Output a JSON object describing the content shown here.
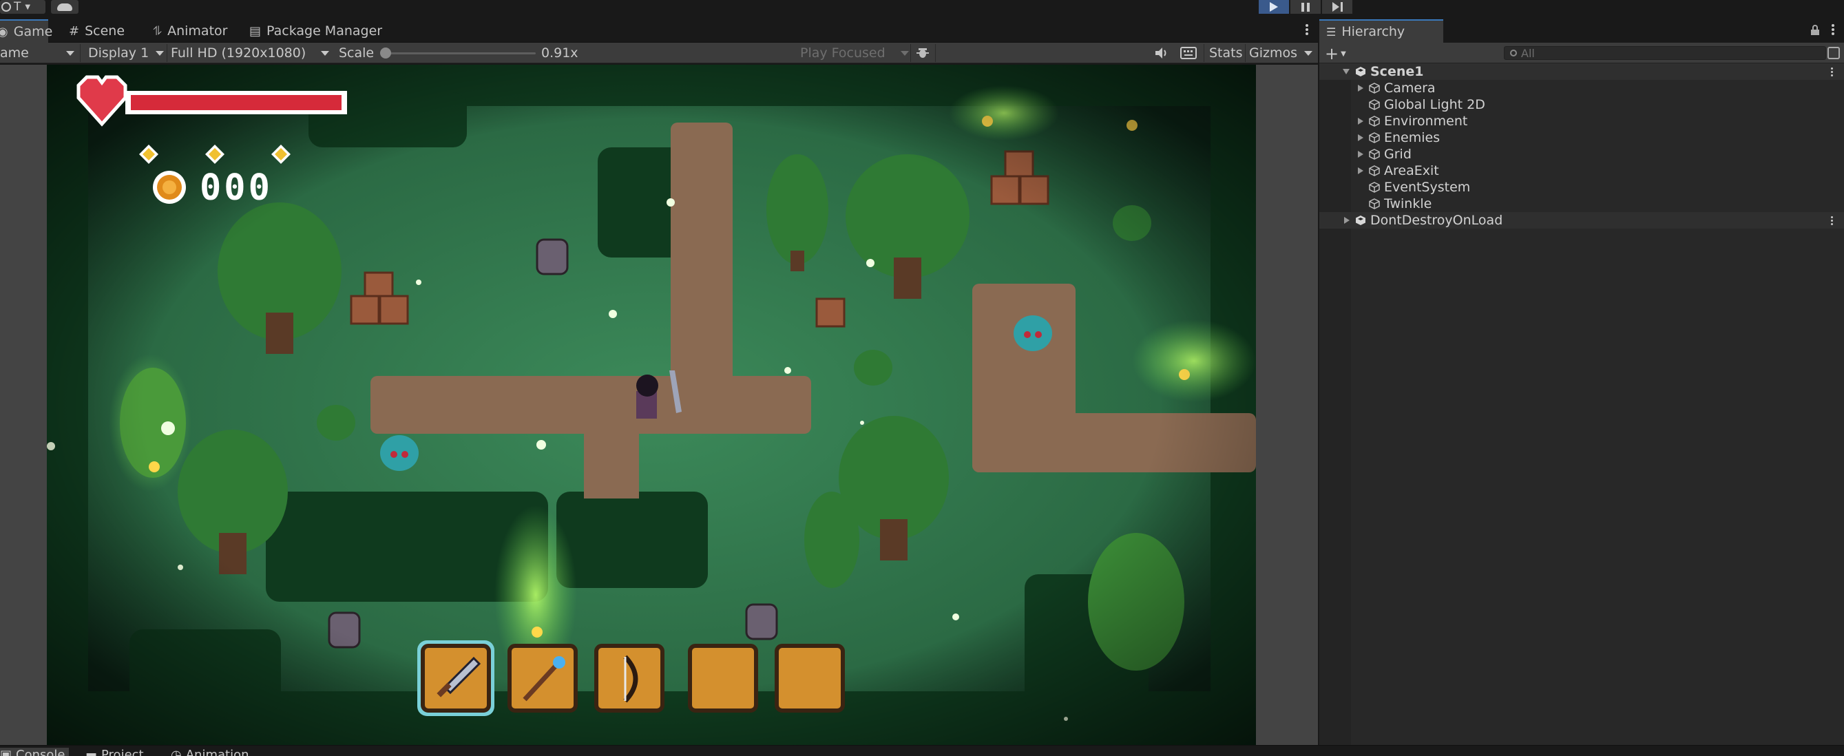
{
  "topbar": {
    "account_label": "T",
    "play_state": "playing"
  },
  "game_panel": {
    "tabs": [
      {
        "label": "Game",
        "icon": "gamepad-icon",
        "active": true
      },
      {
        "label": "Scene",
        "icon": "grid-icon",
        "active": false
      },
      {
        "label": "Animator",
        "icon": "animator-icon",
        "active": false
      },
      {
        "label": "Package Manager",
        "icon": "package-icon",
        "active": false
      }
    ],
    "toolbar": {
      "mode": "ame",
      "display": "Display 1",
      "resolution": "Full HD (1920x1080)",
      "scale_label": "Scale",
      "scale_value": "0.91x",
      "scale_fraction": 0.0,
      "play_focus": "Play Focused",
      "stats": "Stats",
      "gizmos": "Gizmos"
    }
  },
  "hud": {
    "health_fraction": 1.0,
    "gem_count": 3,
    "coins": "000",
    "hotbar": [
      {
        "item": "sword-icon",
        "selected": true
      },
      {
        "item": "staff-icon",
        "selected": false
      },
      {
        "item": "bow-icon",
        "selected": false
      },
      {
        "item": "",
        "selected": false
      },
      {
        "item": "",
        "selected": false
      }
    ]
  },
  "hierarchy": {
    "tab_label": "Hierarchy",
    "search_placeholder": "All",
    "items": [
      {
        "label": "Scene1",
        "type": "scene",
        "expanded": true,
        "arrow": "down"
      },
      {
        "label": "Camera",
        "type": "object",
        "arrow": "right"
      },
      {
        "label": "Global Light 2D",
        "type": "object",
        "arrow": ""
      },
      {
        "label": "Environment",
        "type": "object",
        "arrow": "right"
      },
      {
        "label": "Enemies",
        "type": "object",
        "arrow": "right"
      },
      {
        "label": "Grid",
        "type": "object",
        "arrow": "right"
      },
      {
        "label": "AreaExit",
        "type": "object",
        "arrow": "right"
      },
      {
        "label": "EventSystem",
        "type": "object",
        "arrow": ""
      },
      {
        "label": "Twinkle",
        "type": "object",
        "arrow": ""
      },
      {
        "label": "DontDestroyOnLoad",
        "type": "scene",
        "arrow": "right"
      }
    ]
  },
  "bottom_tabs": [
    {
      "label": "Console",
      "icon": "console-icon"
    },
    {
      "label": "Project",
      "icon": "folder-icon"
    },
    {
      "label": "Animation",
      "icon": "clock-icon"
    }
  ]
}
